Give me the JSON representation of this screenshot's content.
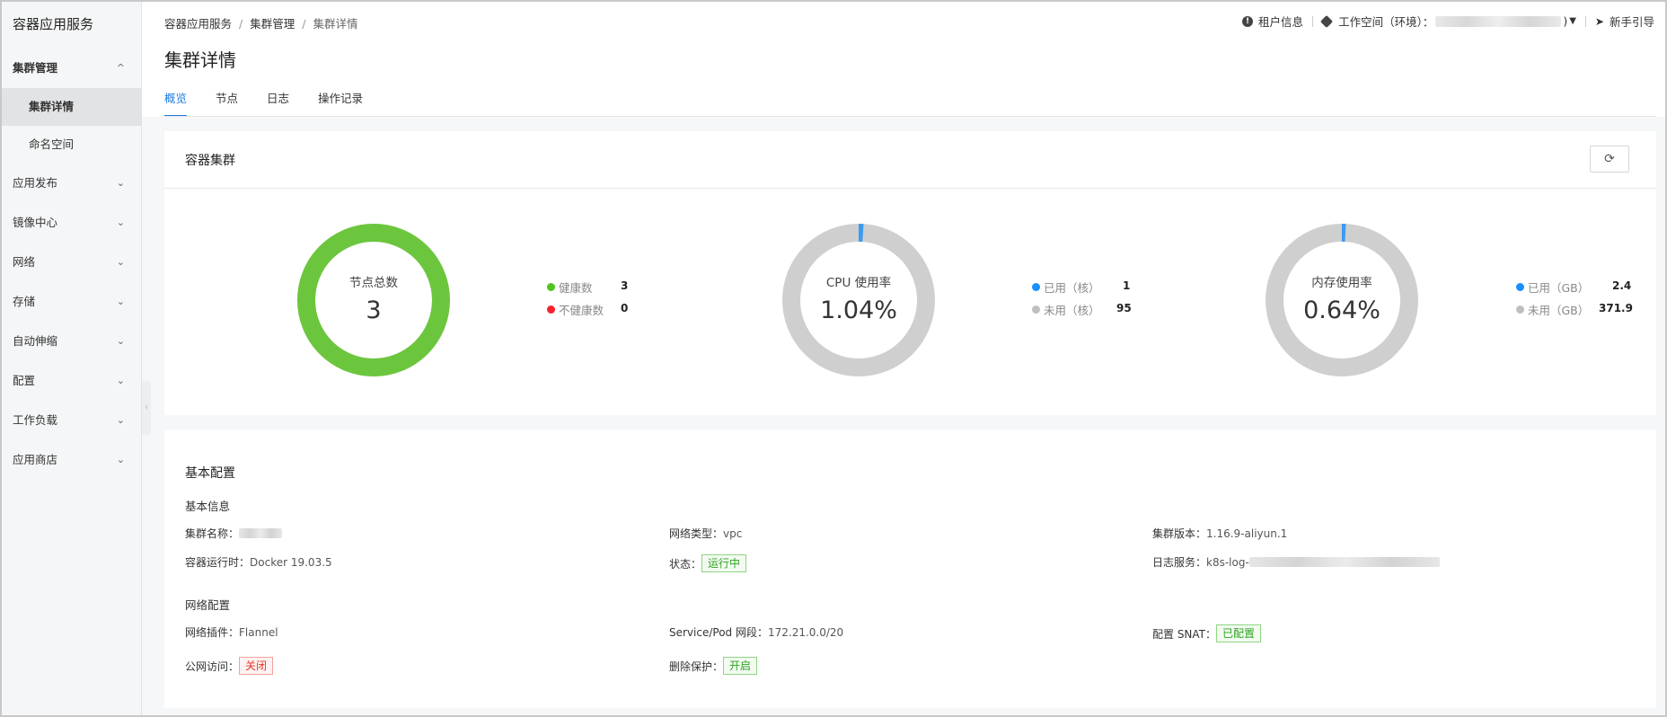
{
  "app_title": "容器应用服务",
  "sidebar": {
    "items": [
      {
        "label": "集群管理",
        "chevron": "^"
      },
      {
        "label": "集群详情"
      },
      {
        "label": "命名空间"
      },
      {
        "label": "应用发布",
        "chevron": "⌄"
      },
      {
        "label": "镜像中心",
        "chevron": "⌄"
      },
      {
        "label": "网络",
        "chevron": "⌄"
      },
      {
        "label": "存储",
        "chevron": "⌄"
      },
      {
        "label": "自动伸缩",
        "chevron": "⌄"
      },
      {
        "label": "配置",
        "chevron": "⌄"
      },
      {
        "label": "工作负载",
        "chevron": "⌄"
      },
      {
        "label": "应用商店",
        "chevron": "⌄"
      }
    ]
  },
  "breadcrumb": [
    "容器应用服务",
    "集群管理",
    "集群详情"
  ],
  "topbar": {
    "tenant": "租户信息",
    "workspace_label": "工作空间（环境）：",
    "workspace_suffix": ")",
    "guide": "新手引导"
  },
  "page_title": "集群详情",
  "tabs": [
    "概览",
    "节点",
    "日志",
    "操作记录"
  ],
  "overview": {
    "card_title": "容器集群",
    "nodes": {
      "label": "节点总数",
      "value": "3",
      "fill_fraction": 1.0,
      "legend": [
        {
          "label": "健康数",
          "value": "3",
          "color": "#52c41a"
        },
        {
          "label": "不健康数",
          "value": "0",
          "color": "#f5222d"
        }
      ]
    },
    "cpu": {
      "label": "CPU 使用率",
      "value": "1.04%",
      "fill_fraction": 0.0104,
      "legend": [
        {
          "label": "已用（核）",
          "value": "1",
          "color": "#1890ff"
        },
        {
          "label": "未用（核）",
          "value": "95",
          "color": "#bfbfbf"
        }
      ]
    },
    "memory": {
      "label": "内存使用率",
      "value": "0.64%",
      "fill_fraction": 0.0064,
      "legend": [
        {
          "label": "已用（GB）",
          "value": "2.4",
          "color": "#1890ff"
        },
        {
          "label": "未用（GB）",
          "value": "371.9",
          "color": "#bfbfbf"
        }
      ]
    }
  },
  "config": {
    "title": "基本配置",
    "basic_title": "基本信息",
    "cluster_name_label": "集群名称：",
    "network_type_label": "网络类型：",
    "network_type": "vpc",
    "cluster_version_label": "集群版本：",
    "cluster_version": "1.16.9-aliyun.1",
    "runtime_label": "容器运行时：",
    "runtime": "Docker 19.03.5",
    "status_label": "状态：",
    "status": "运行中",
    "log_label": "日志服务：",
    "log_value": "k8s-log-",
    "network_title": "网络配置",
    "plugin_label": "网络插件：",
    "plugin": "Flannel",
    "cidr_label": "Service/Pod 网段：",
    "cidr": "172.21.0.0/20",
    "snat_label": "配置 SNAT：",
    "snat": "已配置",
    "public_label": "公网访问：",
    "public": "关闭",
    "delete_protect_label": "删除保护：",
    "delete_protect": "开启"
  },
  "colors": {
    "accent": "#1e7be0",
    "healthy": "#6cc63d",
    "track": "#cfcfcf",
    "used": "#3b9bf0"
  }
}
